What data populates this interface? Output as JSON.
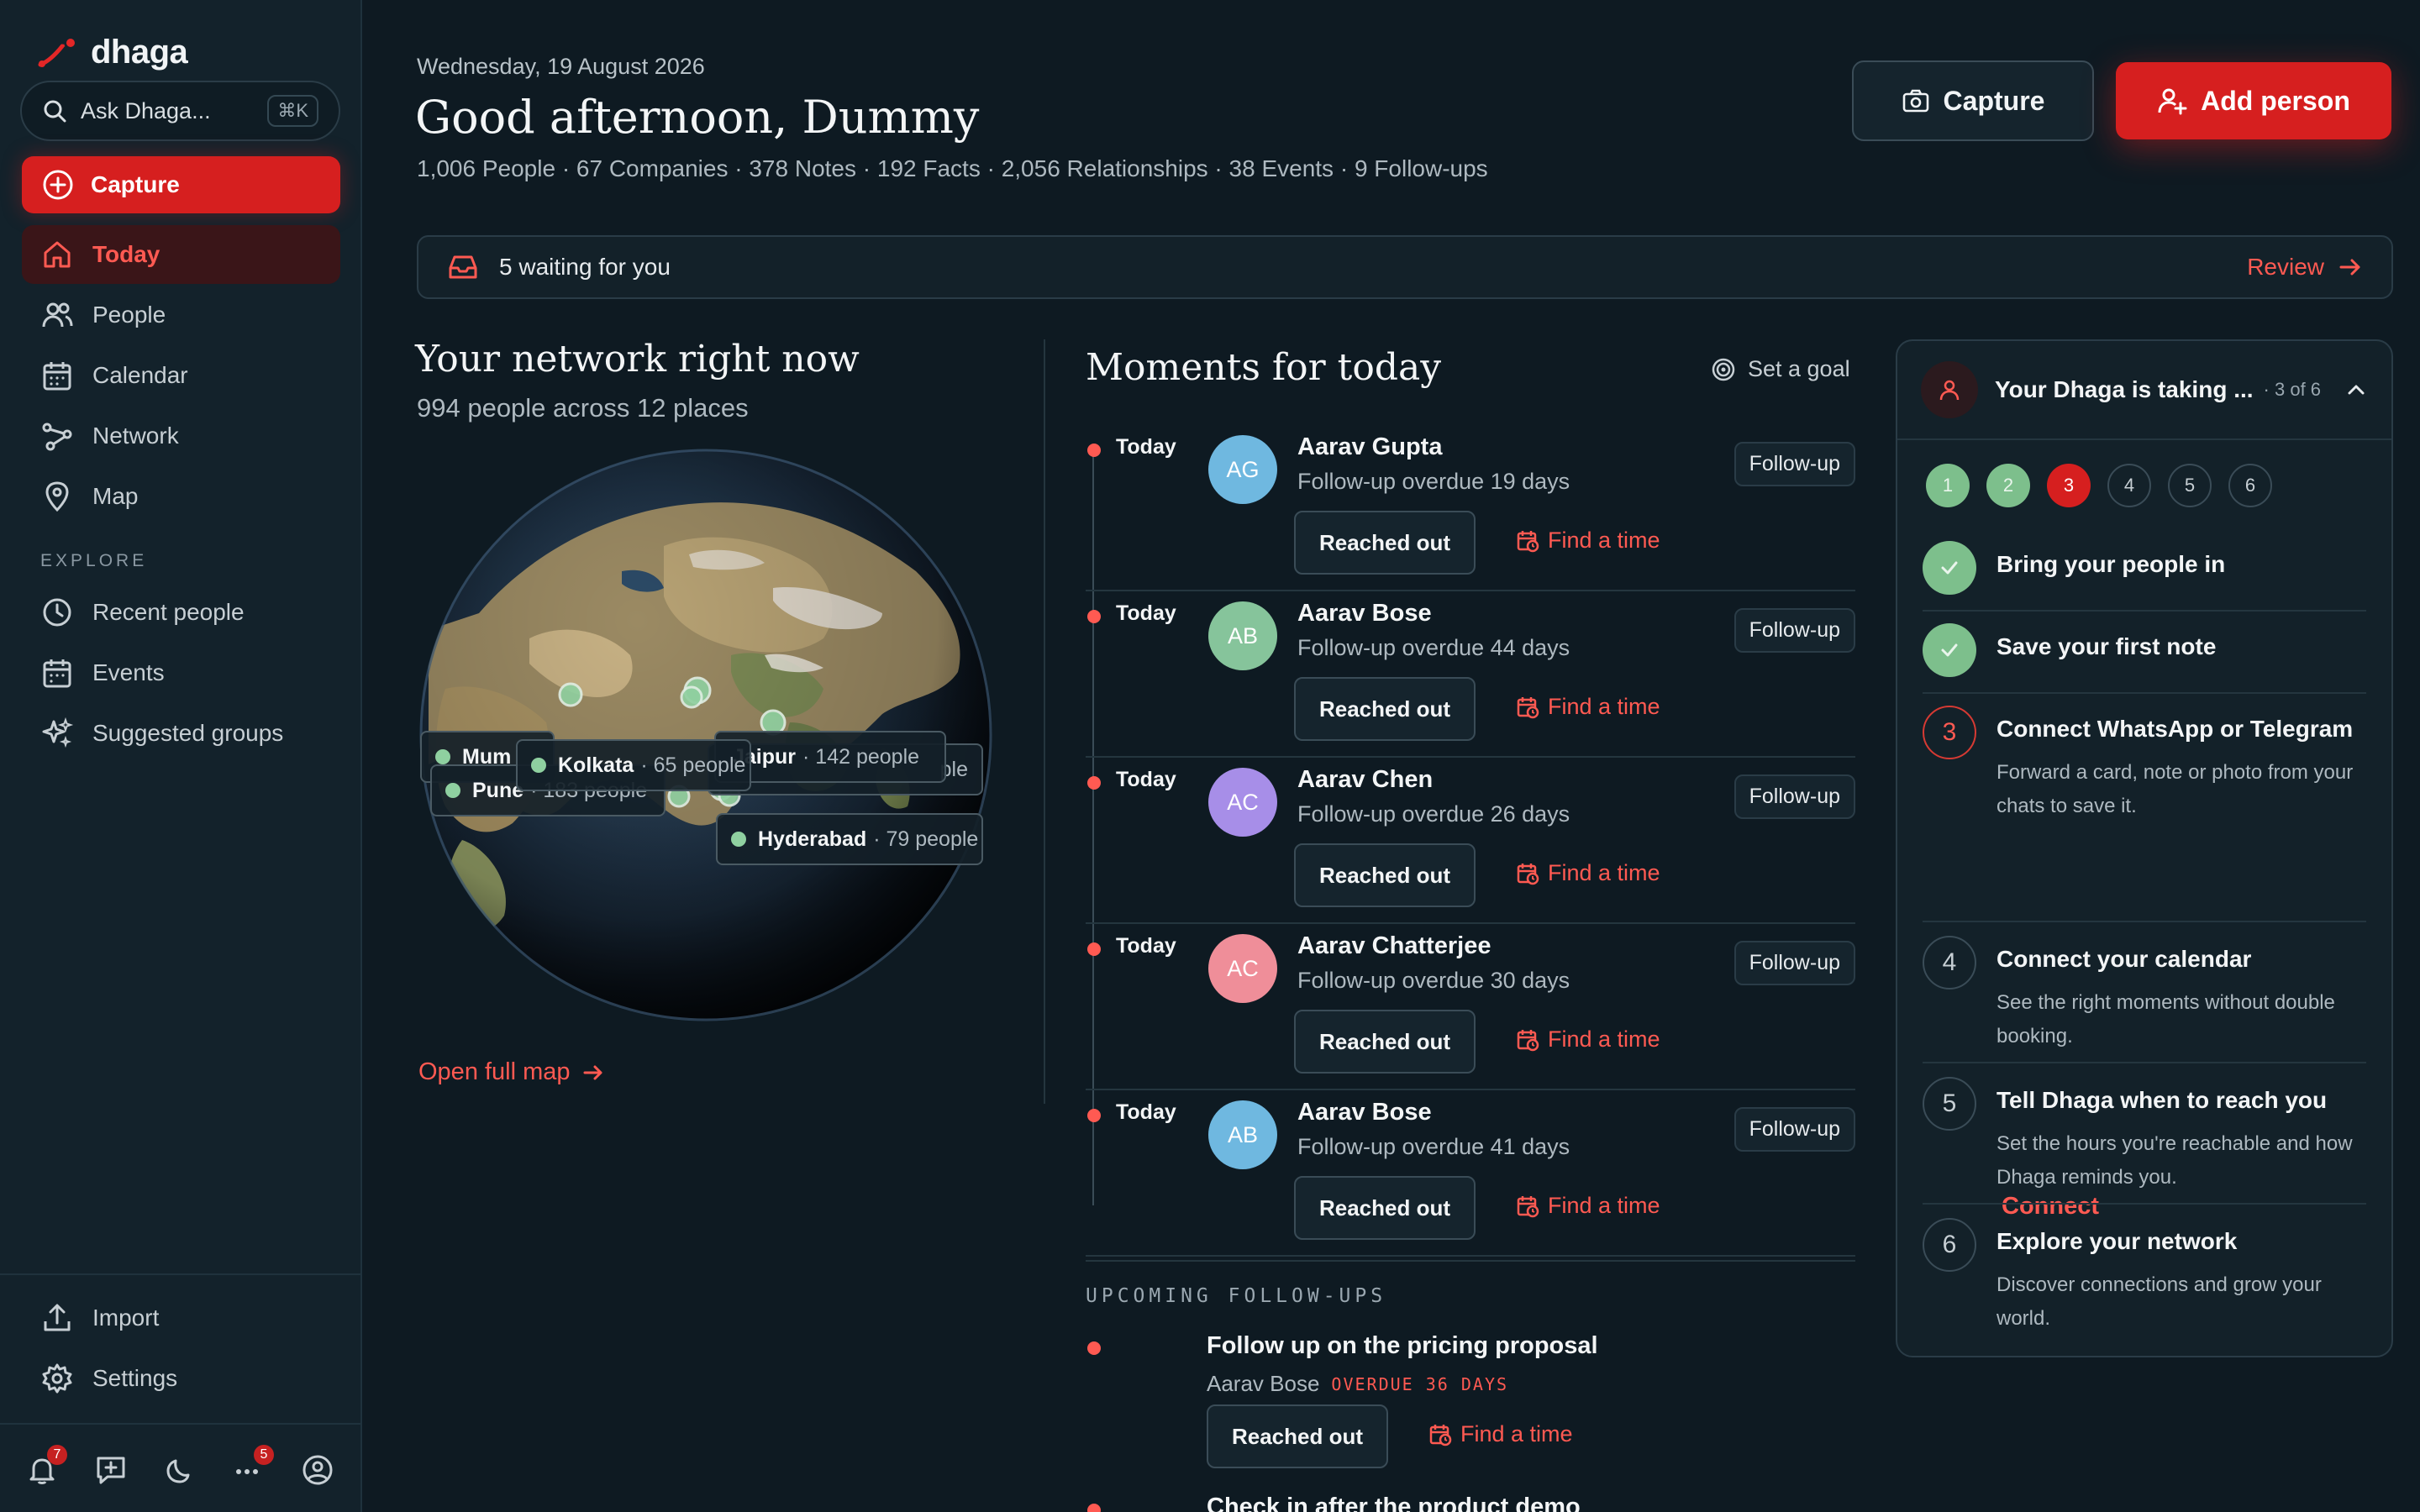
{
  "app": {
    "name": "dhaga"
  },
  "search": {
    "placeholder": "Ask Dhaga...",
    "shortcut": "⌘K"
  },
  "sidebar": {
    "capture_label": "Capture",
    "nav": [
      {
        "label": "Today",
        "icon": "home-icon",
        "active": true
      },
      {
        "label": "People",
        "icon": "people-icon"
      },
      {
        "label": "Calendar",
        "icon": "calendar-icon"
      },
      {
        "label": "Network",
        "icon": "network-icon"
      },
      {
        "label": "Map",
        "icon": "map-pin-icon"
      }
    ],
    "explore_label": "EXPLORE",
    "explore": [
      {
        "label": "Recent people",
        "icon": "clock-icon"
      },
      {
        "label": "Events",
        "icon": "calendar-icon"
      },
      {
        "label": "Suggested groups",
        "icon": "sparkles-icon"
      }
    ],
    "bottom": [
      {
        "label": "Import",
        "icon": "upload-icon"
      },
      {
        "label": "Settings",
        "icon": "gear-icon"
      }
    ],
    "toolbar": {
      "notifications_count": "7",
      "more_count": "5"
    }
  },
  "header": {
    "date": "Wednesday, 19 August 2026",
    "greeting": "Good afternoon, Dummy",
    "stats": "1,006 People · 67 Companies · 378 Notes · 192 Facts · 2,056 Relationships · 38 Events · 9 Follow-ups",
    "capture_label": "Capture",
    "add_person_label": "Add person"
  },
  "waiting": {
    "text": "5 waiting for you",
    "review_label": "Review"
  },
  "network": {
    "title": "Your network right now",
    "subtitle": "994 people across 12 places",
    "open_map_label": "Open full map",
    "cities": [
      {
        "name": "Mumbai",
        "shown": "Mum",
        "count": ""
      },
      {
        "name": "Pune",
        "count": "· 183 people"
      },
      {
        "name": "Kolkata",
        "count": "· 65 people"
      },
      {
        "name": "Jaipur",
        "count": "· 142 people"
      },
      {
        "name": "Hyderabad",
        "count": "· 79 people"
      },
      {
        "name": "",
        "count": "ple"
      }
    ]
  },
  "moments": {
    "title": "Moments for today",
    "set_goal_label": "Set a goal",
    "reached_label": "Reached out",
    "find_label": "Find a time",
    "items": [
      {
        "when": "Today",
        "initials": "AG",
        "name": "Aarav Gupta",
        "desc": "Follow-up overdue 19 days",
        "tag": "Follow-up",
        "color": "#6fb8e0"
      },
      {
        "when": "Today",
        "initials": "AB",
        "name": "Aarav Bose",
        "desc": "Follow-up overdue 44 days",
        "tag": "Follow-up",
        "color": "#86c49b"
      },
      {
        "when": "Today",
        "initials": "AC",
        "name": "Aarav Chen",
        "desc": "Follow-up overdue 26 days",
        "tag": "Follow-up",
        "color": "#a78ee8"
      },
      {
        "when": "Today",
        "initials": "AC",
        "name": "Aarav Chatterjee",
        "desc": "Follow-up overdue 30 days",
        "tag": "Follow-up",
        "color": "#ef8e99"
      },
      {
        "when": "Today",
        "initials": "AB",
        "name": "Aarav Bose",
        "desc": "Follow-up overdue 41 days",
        "tag": "Follow-up",
        "color": "#6fb8e0"
      }
    ],
    "upcoming_label": "UPCOMING FOLLOW-UPS",
    "upcoming": [
      {
        "title": "Follow up on the pricing proposal",
        "who": "Aarav Bose",
        "status": "OVERDUE 36 DAYS"
      },
      {
        "title": "Check in after the product demo"
      }
    ]
  },
  "onboarding": {
    "title": "Your Dhaga is taking ...",
    "count": "· 3 of 6",
    "steps": [
      "1",
      "2",
      "3",
      "4",
      "5",
      "6"
    ],
    "current_step": 3,
    "tasks": [
      {
        "num": "1",
        "title": "Bring your people in",
        "status": "done"
      },
      {
        "num": "2",
        "title": "Save your first note",
        "status": "done"
      },
      {
        "num": "3",
        "title": "Connect WhatsApp or Telegram",
        "desc": "Forward a card, note or photo from your chats to save it.",
        "action": "Connect",
        "status": "current"
      },
      {
        "num": "4",
        "title": "Connect your calendar",
        "desc": "See the right moments without double booking.",
        "status": "todo"
      },
      {
        "num": "5",
        "title": "Tell Dhaga when to reach you",
        "desc": "Set the hours you're reachable and how Dhaga reminds you.",
        "status": "todo"
      },
      {
        "num": "6",
        "title": "Explore your network",
        "desc": "Discover connections and grow your world.",
        "status": "todo"
      }
    ]
  },
  "colors": {
    "accent": "#d61f1f",
    "accent_text": "#ff5a52",
    "background": "#0e1a22",
    "sidebar": "#13222b",
    "success": "#7dbf8c"
  }
}
